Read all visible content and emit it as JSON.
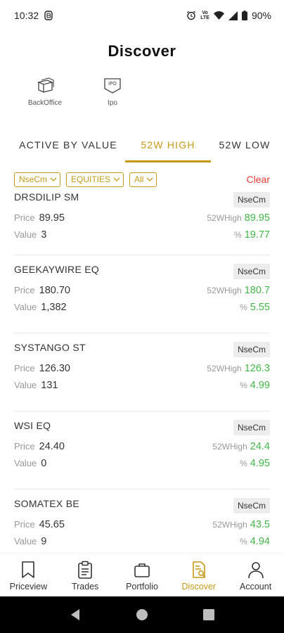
{
  "status": {
    "time": "10:32",
    "net": "Vo\nLTE",
    "battery": "90%"
  },
  "title": "Discover",
  "shortcuts": [
    {
      "label": "BackOffice",
      "icon": "backoffice-icon"
    },
    {
      "label": "Ipo",
      "icon": "ipo-icon",
      "badge": "IPO"
    }
  ],
  "tabs": [
    {
      "label": "ACTIVE BY VALUE"
    },
    {
      "label": "52W HIGH",
      "active": true
    },
    {
      "label": "52W LOW"
    }
  ],
  "filters": {
    "exchange": "NseCm",
    "segment": "EQUITIES",
    "series": "All",
    "clear_label": "Clear"
  },
  "labels": {
    "price": "Price",
    "value": "Value",
    "high": "52WHigh",
    "pct": "%"
  },
  "stocks": [
    {
      "symbol": "DRSDILIP SM",
      "exchange": "NseCm",
      "price": "89.95",
      "value": "3",
      "high": "89.95",
      "pct": "19.77"
    },
    {
      "symbol": "GEEKAYWIRE EQ",
      "exchange": "NseCm",
      "price": "180.70",
      "value": "1,382",
      "high": "180.7",
      "pct": "5.55"
    },
    {
      "symbol": "SYSTANGO ST",
      "exchange": "NseCm",
      "price": "126.30",
      "value": "131",
      "high": "126.3",
      "pct": "4.99"
    },
    {
      "symbol": "WSI EQ",
      "exchange": "NseCm",
      "price": "24.40",
      "value": "0",
      "high": "24.4",
      "pct": "4.95"
    },
    {
      "symbol": "SOMATEX BE",
      "exchange": "NseCm",
      "price": "45.65",
      "value": "9",
      "high": "43.5",
      "pct": "4.94"
    }
  ],
  "nav": [
    {
      "label": "Priceview",
      "icon": "bookmark-icon"
    },
    {
      "label": "Trades",
      "icon": "clipboard-icon"
    },
    {
      "label": "Portfolio",
      "icon": "briefcase-icon"
    },
    {
      "label": "Discover",
      "icon": "discover-icon",
      "active": true
    },
    {
      "label": "Account",
      "icon": "user-icon"
    }
  ],
  "colors": {
    "accent": "#c49a16",
    "positive": "#43b548",
    "clear": "#e53935"
  }
}
